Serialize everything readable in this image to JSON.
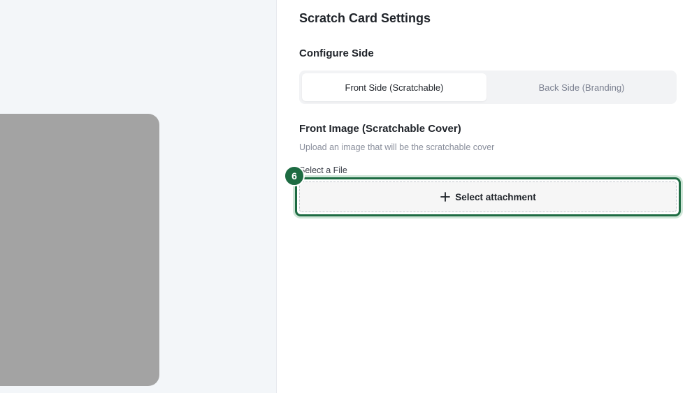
{
  "panel": {
    "title": "Scratch Card Settings"
  },
  "configure_side": {
    "label": "Configure Side",
    "options": [
      {
        "label": "Front Side (Scratchable)",
        "active": true
      },
      {
        "label": "Back Side (Branding)",
        "active": false
      }
    ]
  },
  "front_image": {
    "title": "Front Image (Scratchable Cover)",
    "description": "Upload an image that will be the scratchable cover",
    "file_label": "Select a File",
    "button_label": "Select attachment",
    "button_icon": "plus-icon"
  },
  "step_badge": {
    "number": "6"
  },
  "colors": {
    "accent": "#1d6b42",
    "card_preview": "#a3a3a3",
    "preview_background": "#f3f6f9"
  }
}
